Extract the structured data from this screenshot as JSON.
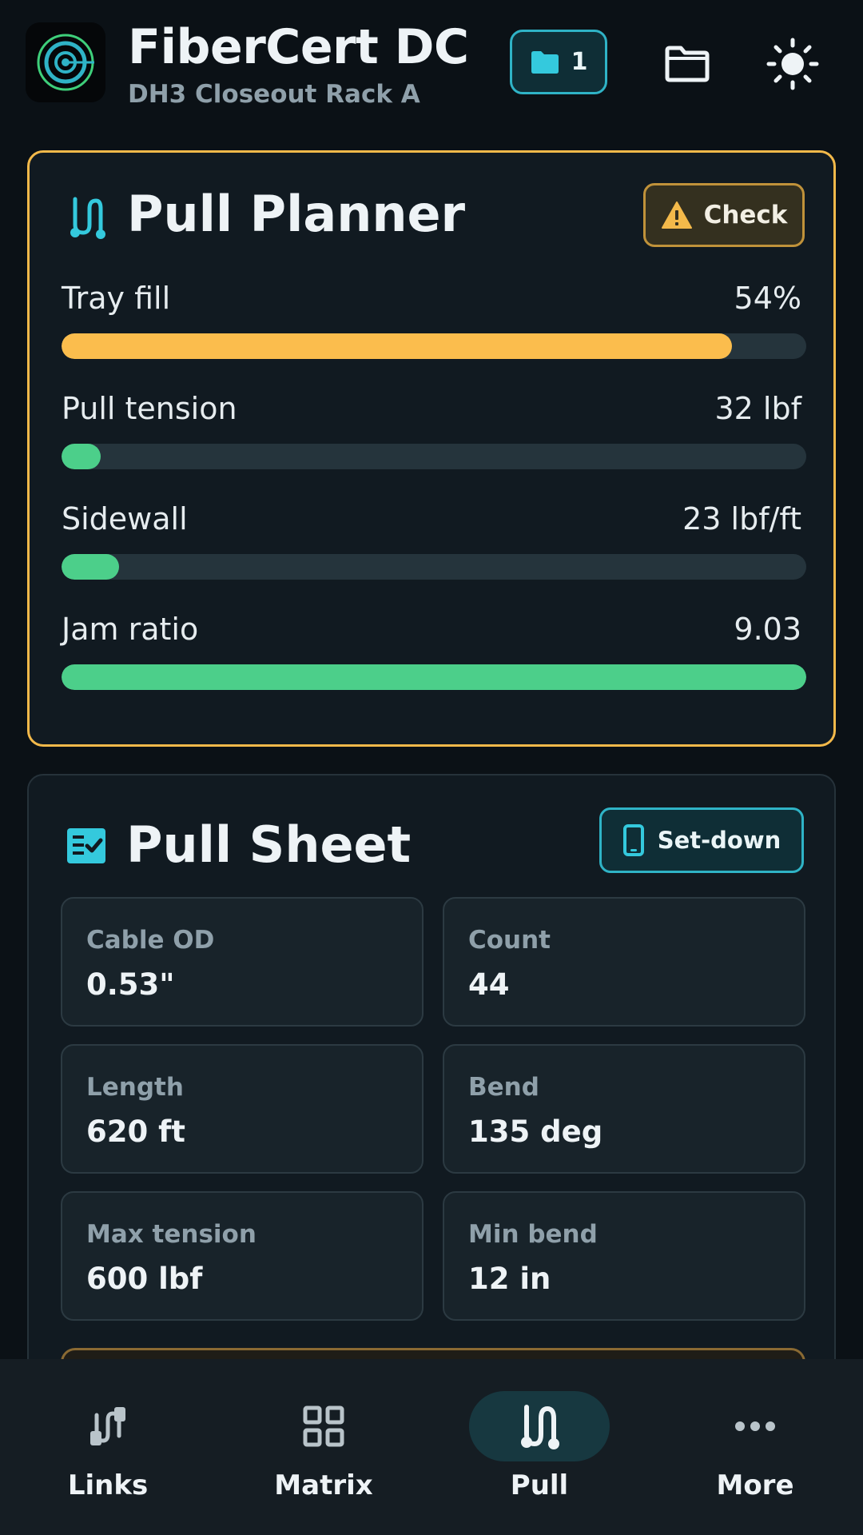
{
  "header": {
    "title": "FiberCert DC",
    "subtitle": "DH3 Closeout Rack A",
    "folder_count": "1",
    "icons": [
      "logo-target-icon",
      "folder-filled-icon",
      "folder-outline-icon",
      "sun-icon"
    ]
  },
  "planner": {
    "title": "Pull Planner",
    "icon": "cable-route-icon",
    "check_label": "Check",
    "metrics": [
      {
        "label": "Tray fill",
        "value": "54%",
        "level": 0.9,
        "color": "#fbbd4d"
      },
      {
        "label": "Pull tension",
        "value": "32 lbf",
        "level": 0.053,
        "color": "#4ccf8a"
      },
      {
        "label": "Sidewall",
        "value": "23 lbf/ft",
        "level": 0.077,
        "color": "#4ccf8a"
      },
      {
        "label": "Jam ratio",
        "value": "9.03",
        "level": 1.0,
        "color": "#4ccf8a"
      }
    ]
  },
  "sheet": {
    "title": "Pull Sheet",
    "icon": "checklist-icon",
    "setdown_label": "Set-down",
    "tiles": [
      {
        "label": "Cable OD",
        "value": "0.53\""
      },
      {
        "label": "Count",
        "value": "44"
      },
      {
        "label": "Length",
        "value": "620 ft"
      },
      {
        "label": "Bend",
        "value": "135 deg"
      },
      {
        "label": "Max tension",
        "value": "600 lbf"
      },
      {
        "label": "Min bend",
        "value": "12 in"
      }
    ]
  },
  "nav": {
    "items": [
      {
        "label": "Links",
        "icon": "cable-links-icon",
        "active": false
      },
      {
        "label": "Matrix",
        "icon": "grid-icon",
        "active": false
      },
      {
        "label": "Pull",
        "icon": "cable-route-icon",
        "active": true
      },
      {
        "label": "More",
        "icon": "more-dots-icon",
        "active": false
      }
    ]
  },
  "colors": {
    "accent": "#2fb3c6",
    "warning": "#f3b94a",
    "ok": "#4ccf8a",
    "background": "#0b1116"
  }
}
